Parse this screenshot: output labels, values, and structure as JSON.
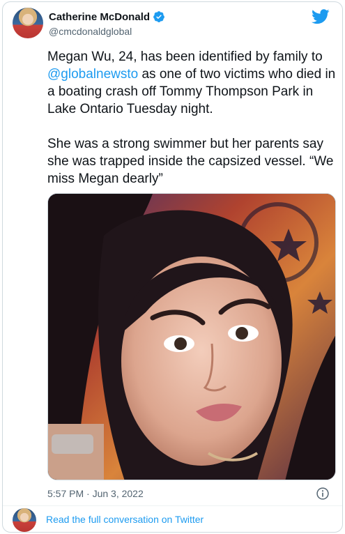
{
  "author": {
    "display_name": "Catherine McDonald",
    "handle": "@cmcdonaldglobal",
    "verified": true
  },
  "tweet": {
    "text_before_mention": "Megan Wu, 24, has been identified by family to ",
    "mention": "@globalnewsto",
    "text_after_mention": " as one of two victims who died in a boating crash off Tommy Thompson Park in Lake Ontario Tuesday night.\n\nShe was a strong swimmer but her parents say she was trapped inside the capsized vessel. “We miss Megan dearly”",
    "timestamp": "5:57 PM · Jun 3, 2022"
  },
  "footer": {
    "link_text": "Read the full conversation on Twitter"
  },
  "icons": {
    "brand": "twitter-bird-icon",
    "verified": "verified-badge-icon",
    "info": "info-icon"
  },
  "colors": {
    "accent": "#1d9bf0",
    "text": "#0f1419",
    "muted": "#536471",
    "border": "#cfd9de"
  }
}
